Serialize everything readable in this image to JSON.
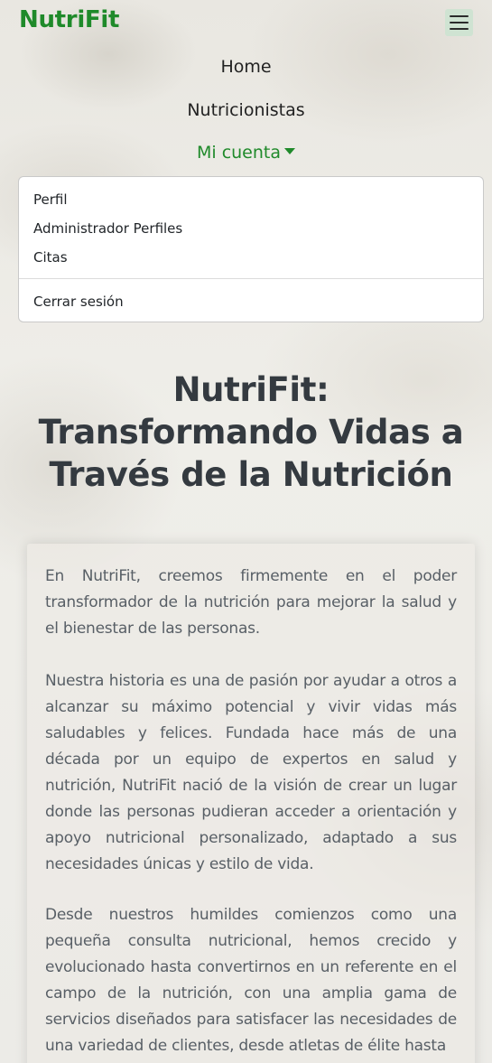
{
  "navbar": {
    "brand": "NutriFit",
    "toggler_icon": "hamburger-menu-icon",
    "links": {
      "home": "Home",
      "nutricionistas": "Nutricionistas",
      "mi_cuenta": "Mi cuenta"
    },
    "dropdown": {
      "perfil": "Perfil",
      "admin_perfiles": "Administrador Perfiles",
      "citas": "Citas",
      "cerrar_sesion": "Cerrar sesión"
    }
  },
  "main": {
    "title": "NutriFit: Transformando Vidas a Través de la Nutrición",
    "paragraphs": [
      "En NutriFit, creemos firmemente en el poder transformador de la nutrición para mejorar la salud y el bienestar de las personas.",
      "Nuestra historia es una de pasión por ayudar a otros a alcanzar su máximo potencial y vivir vidas más saludables y felices. Fundada hace más de una década por un equipo de expertos en salud y nutrición, NutriFit nació de la visión de crear un lugar donde las personas pudieran acceder a orientación y apoyo nutricional personalizado, adaptado a sus necesidades únicas y estilo de vida.",
      "Desde nuestros humildes comienzos como una pequeña consulta nutricional, hemos crecido y evolucionado hasta convertirnos en un referente en el campo de la nutrición, con una amplia gama de servicios diseñados para satisfacer las necesidades de una variedad de clientes, desde atletas de élite hasta"
    ]
  },
  "colors": {
    "brand_green": "#1f8a2a",
    "toggler_bg": "#cfe3d2",
    "title_text": "#343a40",
    "body_text": "#585f66"
  }
}
